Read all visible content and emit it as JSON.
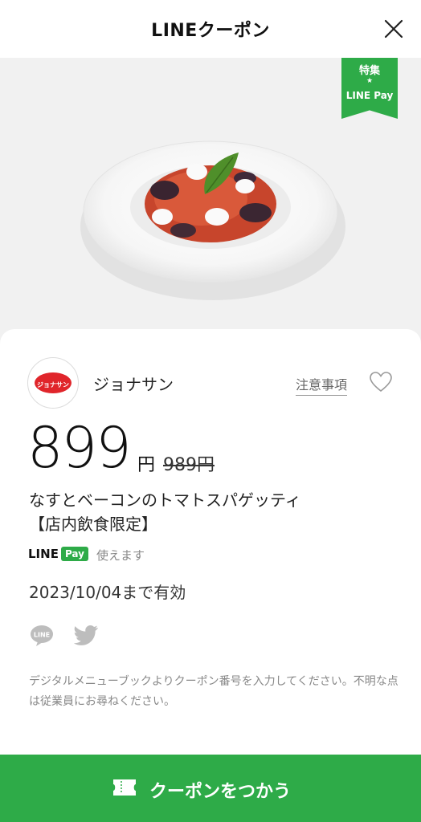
{
  "header": {
    "title": "LINEクーポン",
    "close_icon": "close-icon"
  },
  "badge": {
    "label_top": "特集",
    "star": "★",
    "label_bottom": "LINE Pay"
  },
  "coupon": {
    "shop_name": "ジョナサン",
    "shop_logo_text": "ジョナサン",
    "notes_label": "注意事項",
    "price": "899",
    "yen": "円",
    "original_price": "989円",
    "item_name_line1": "なすとベーコンのトマトスパゲッティ",
    "item_name_line2": "【店内飲食限定】",
    "linepay_line": "LINE",
    "linepay_pay": "Pay",
    "usable_label": "使えます",
    "expiry": "2023/10/04まで有効",
    "description": "デジタルメニューブックよりクーポン番号を入力してください。不明な点は従業員にお尋ねください。"
  },
  "cta": {
    "label": "クーポンをつかう"
  },
  "colors": {
    "accent_green": "#2eab48",
    "brand_red": "#e0252b"
  }
}
